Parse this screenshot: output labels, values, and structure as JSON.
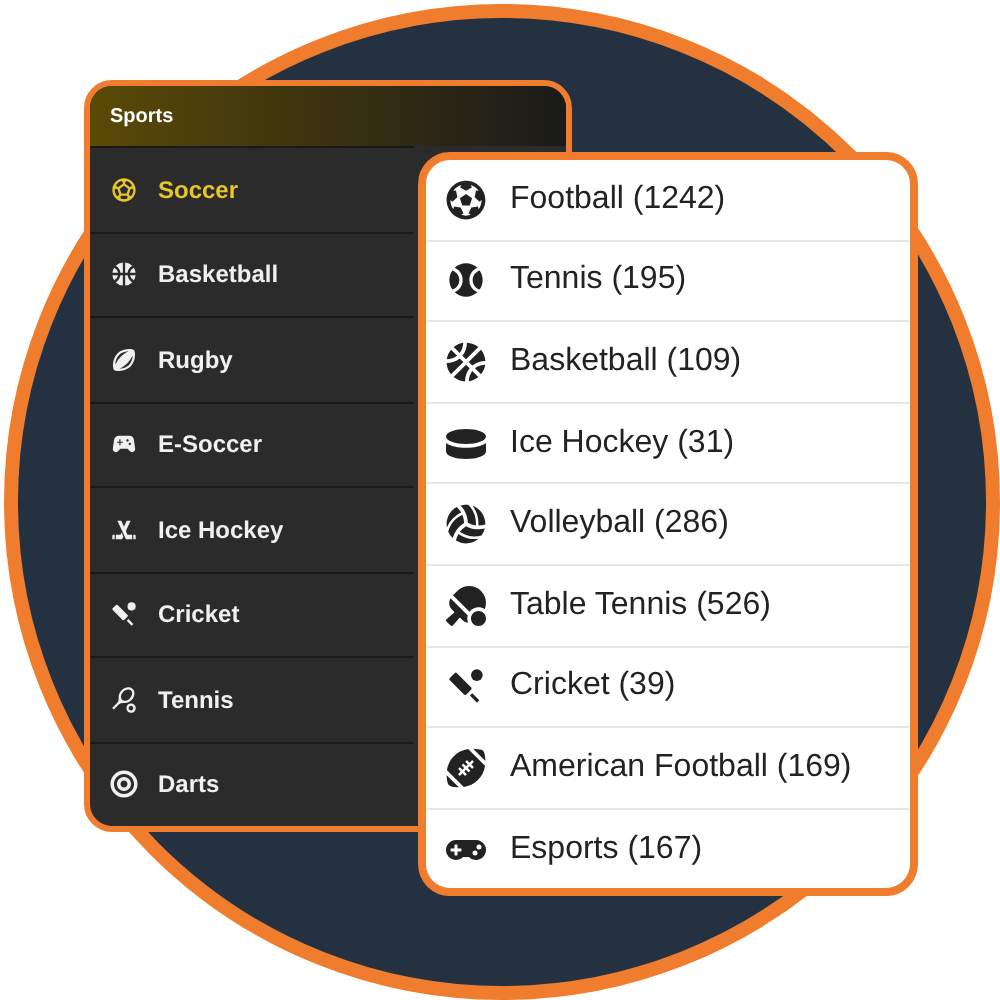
{
  "sports_menu": {
    "title": "Sports",
    "items": [
      {
        "label": "Soccer",
        "selected": true
      },
      {
        "label": "Basketball",
        "selected": false
      },
      {
        "label": "Rugby",
        "selected": false
      },
      {
        "label": "E-Soccer",
        "selected": false
      },
      {
        "label": "Ice Hockey",
        "selected": false
      },
      {
        "label": "Cricket",
        "selected": false
      },
      {
        "label": "Tennis",
        "selected": false
      },
      {
        "label": "Darts",
        "selected": false
      }
    ]
  },
  "sports_list": {
    "items": [
      {
        "label": "Football (1242)"
      },
      {
        "label": "Tennis (195)"
      },
      {
        "label": "Basketball (109)"
      },
      {
        "label": "Ice Hockey (31)"
      },
      {
        "label": "Volleyball (286)"
      },
      {
        "label": "Table Tennis (526)"
      },
      {
        "label": "Cricket (39)"
      },
      {
        "label": "American Football (169)"
      },
      {
        "label": "Esports (167)"
      }
    ]
  }
}
